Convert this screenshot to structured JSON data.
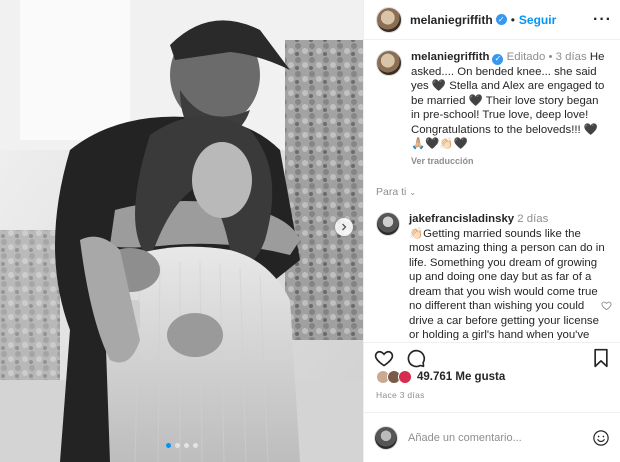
{
  "post": {
    "author": "melaniegriffith",
    "follow_label": "Seguir",
    "more_label": "···",
    "separator": "•"
  },
  "caption": {
    "author": "melaniegriffith",
    "edited": "Editado",
    "time": "3 días",
    "text": "He asked.... On bended knee... she said yes 🖤 Stella and Alex are engaged to be married 🖤 Their love story began in pre-school! True love, deep love! Congratulations to the beloveds!!! 🖤🙏🏼🖤👏🏻🖤",
    "translate": "Ver traducción"
  },
  "sort": {
    "label": "Para ti"
  },
  "comment": {
    "author": "jakefrancisladinsky",
    "time": "2 días",
    "text": "👏🏻Getting married sounds like the most amazing thing a person can do in life. Something you dream of growing up and doing one day but as far of a dream that you wish would come true no different than wishing you could drive a car before getting your license or holding a girl's hand when you've never had a girlfriend. A"
  },
  "stats": {
    "likes": "49.761 Me gusta",
    "ago": "Hace 3 días"
  },
  "add_comment": {
    "placeholder": "Añade un comentario..."
  },
  "carousel": {
    "slide_count": 4,
    "active_index": 0
  },
  "colors": {
    "accent": "#0095f6",
    "verified": "#3897f0",
    "muted": "#8e8e8e",
    "text": "#262626"
  },
  "icons": {
    "verified": "verified-badge-icon",
    "next": "chevron-right-icon",
    "like": "heart-icon",
    "comment": "comment-bubble-icon",
    "share": "paper-plane-icon",
    "save": "bookmark-icon",
    "emoji": "smiley-icon"
  }
}
